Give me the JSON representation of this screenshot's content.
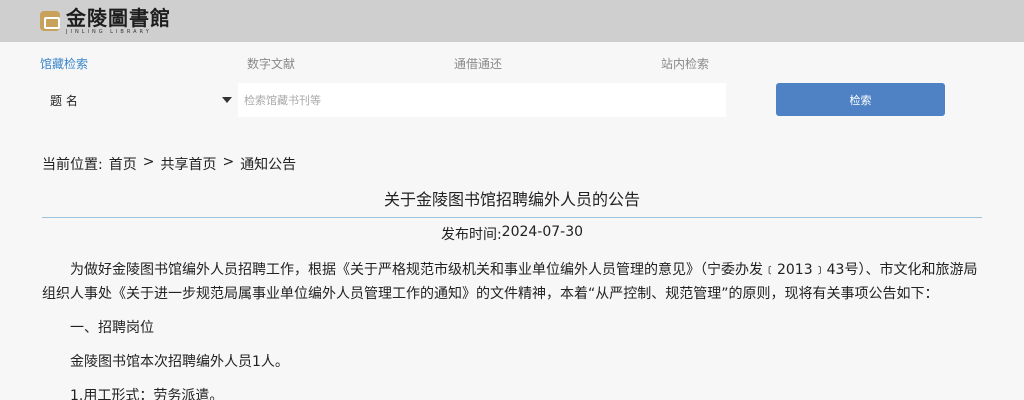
{
  "header": {
    "logo_cn": "金陵圖書館",
    "logo_en": "JINLING LIBRARY"
  },
  "tabs": [
    {
      "label": "馆藏检索",
      "active": true
    },
    {
      "label": "数字文献",
      "active": false
    },
    {
      "label": "通借通还",
      "active": false
    },
    {
      "label": "站内检索",
      "active": false
    }
  ],
  "search": {
    "field": "题 名",
    "placeholder": "检索馆藏书刊等",
    "button": "检索"
  },
  "breadcrumb": {
    "prefix": "当前位置:",
    "items": [
      "首页",
      "共享首页",
      "通知公告"
    ],
    "separator": ">"
  },
  "article": {
    "title": "关于金陵图书馆招聘编外人员的公告",
    "date_label": "发布时间:",
    "date": "2024-07-30",
    "paragraphs": [
      "为做好金陵图书馆编外人员招聘工作，根据《关于严格规范市级机关和事业单位编外人员管理的意见》（宁委办发﹝2013﹞43号）、市文化和旅游局组织人事处《关于进一步规范局属事业单位编外人员管理工作的通知》的文件精神，本着“从严控制、规范管理”的原则，现将有关事项公告如下：",
      "一、招聘岗位",
      "金陵图书馆本次招聘编外人员1人。",
      "1.用工形式：劳务派遣。"
    ]
  },
  "colors": {
    "topbar": "#cfcfcf",
    "accent": "#3a86c8",
    "button": "#4e82c4",
    "divider": "#9cc3de"
  }
}
